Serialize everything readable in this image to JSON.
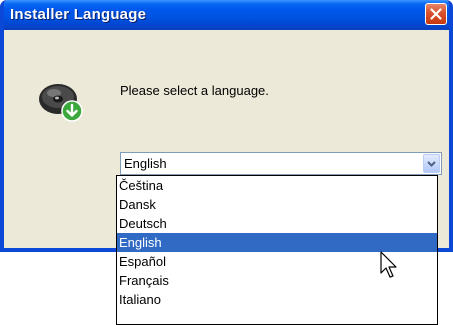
{
  "window": {
    "title": "Installer Language"
  },
  "dialog": {
    "prompt": "Please select a language.",
    "icon": "installer-disc-icon"
  },
  "combo": {
    "selected": "English"
  },
  "dropdown": {
    "options": [
      "Čeština",
      "Dansk",
      "Deutsch",
      "English",
      "Español",
      "Français",
      "Italiano"
    ],
    "highlighted": "English"
  },
  "colors": {
    "titlebar": "#0054e3",
    "close_button": "#d9512c",
    "dialog_background": "#ece9d8",
    "selection": "#316ac5"
  }
}
